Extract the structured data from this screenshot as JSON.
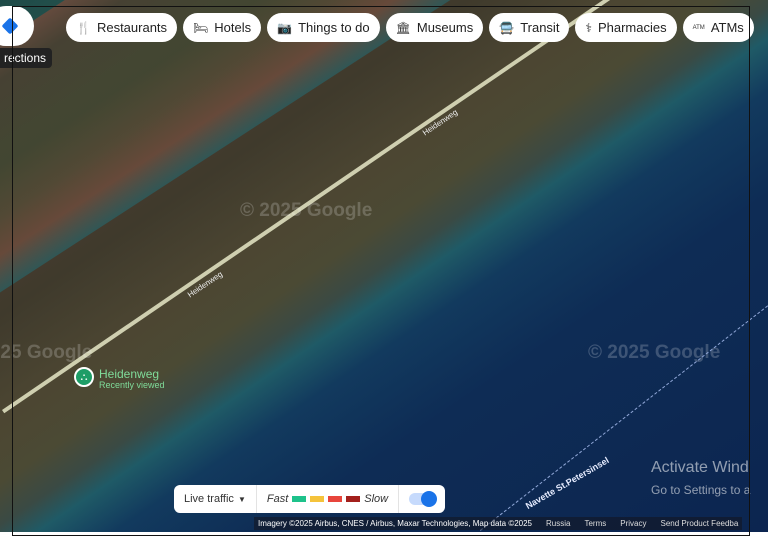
{
  "directions": {
    "tooltip": "rections"
  },
  "chips": [
    {
      "label": "Restaurants",
      "icon": "fork-knife-icon",
      "glyph": "🍴"
    },
    {
      "label": "Hotels",
      "icon": "bed-icon",
      "glyph": "🛏"
    },
    {
      "label": "Things to do",
      "icon": "camera-icon",
      "glyph": "📷"
    },
    {
      "label": "Museums",
      "icon": "museum-icon",
      "glyph": "🏛"
    },
    {
      "label": "Transit",
      "icon": "bus-icon",
      "glyph": "🚍"
    },
    {
      "label": "Pharmacies",
      "icon": "pharmacy-icon",
      "glyph": "⚕"
    },
    {
      "label": "ATMs",
      "icon": "atm-icon",
      "glyph": "ATM"
    }
  ],
  "map": {
    "road_label": "Heidenweg",
    "watermark": "© 2025 Google",
    "ferry_label": "Navette St.Petersinsel"
  },
  "place": {
    "name": "Heidenweg",
    "subtitle": "Recently viewed"
  },
  "traffic": {
    "label": "Live traffic",
    "fast": "Fast",
    "slow": "Slow",
    "colors": [
      "#1ec28b",
      "#f5c33b",
      "#e8453c",
      "#a3201c"
    ],
    "enabled": true
  },
  "attribution": {
    "imagery": "Imagery ©2025 Airbus, CNES / Airbus, Maxar Technologies, Map data ©2025",
    "region": "Russia",
    "terms": "Terms",
    "privacy": "Privacy",
    "feedback": "Send Product Feedba"
  },
  "activation": {
    "title": "Activate Wind",
    "subtitle": "Go to Settings to a"
  }
}
